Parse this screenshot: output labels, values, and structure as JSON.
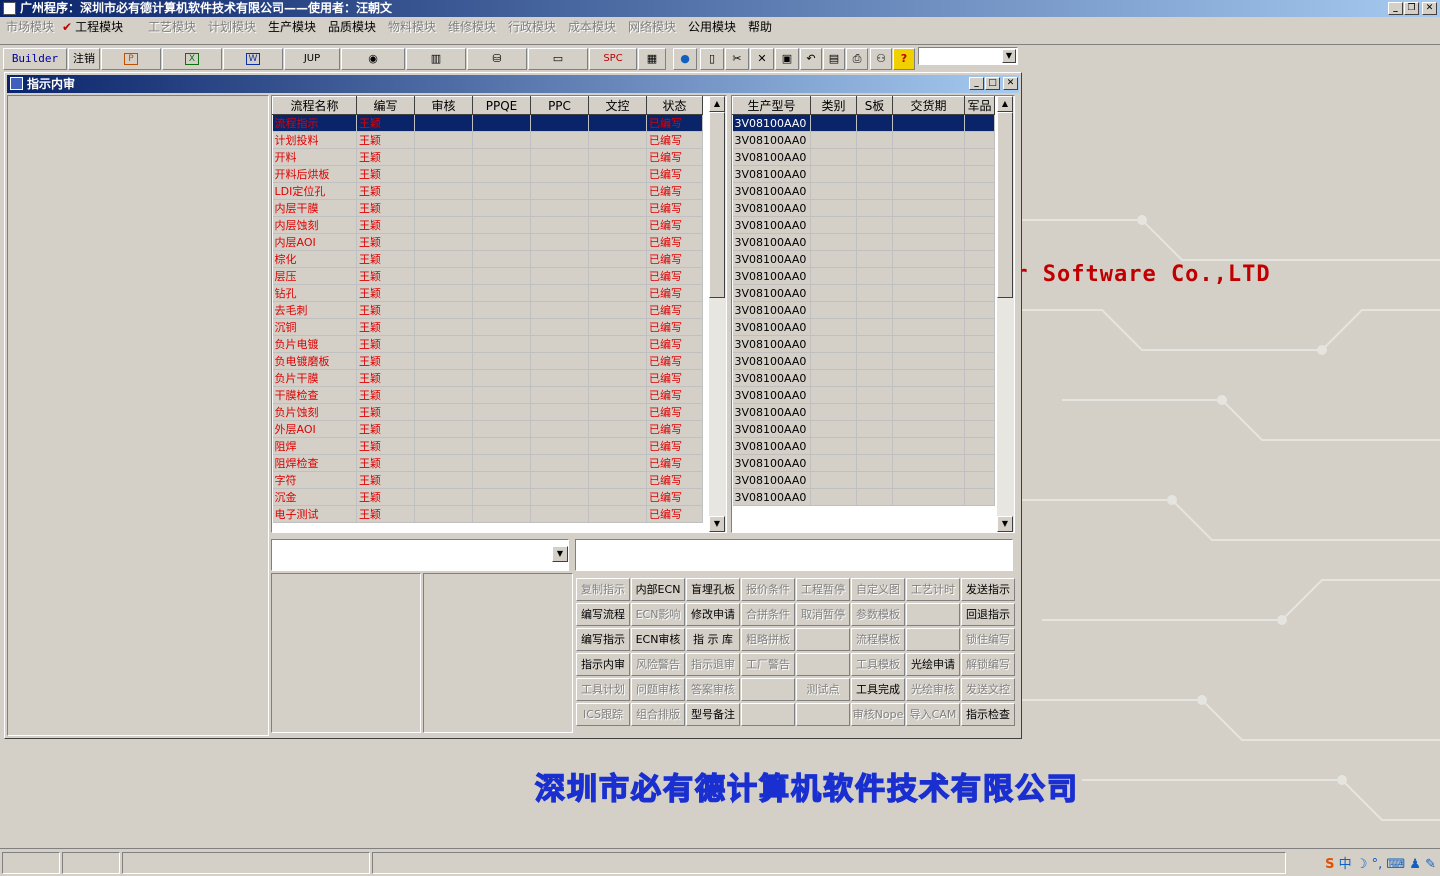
{
  "app": {
    "title": "广州程序：深圳市必有德计算机软件技术有限公司——使用者：汪朝文",
    "min": "_",
    "restore": "❐",
    "close": "✕"
  },
  "menu": [
    {
      "label": "市场模块",
      "enabled": false
    },
    {
      "label": "工程模块",
      "enabled": true,
      "checked": true
    },
    {
      "label": "工艺模块",
      "enabled": false
    },
    {
      "label": "计划模块",
      "enabled": false
    },
    {
      "label": "生产模块",
      "enabled": true
    },
    {
      "label": "品质模块",
      "enabled": true
    },
    {
      "label": "物料模块",
      "enabled": false
    },
    {
      "label": "维修模块",
      "enabled": false
    },
    {
      "label": "行政模块",
      "enabled": false
    },
    {
      "label": "成本模块",
      "enabled": false
    },
    {
      "label": "网络模块",
      "enabled": false
    },
    {
      "label": "公用模块",
      "enabled": true
    },
    {
      "label": "帮助",
      "enabled": true
    }
  ],
  "toolbar": {
    "builder": "Builder",
    "logout": "注销",
    "jup": "JUP",
    "spc": "SPC",
    "combo_value": ""
  },
  "background": {
    "brand_en": "er Software Co.,LTD",
    "brand_cn": "深圳市必有德计算机软件技术有限公司"
  },
  "window": {
    "title": "指示内审"
  },
  "process_grid": {
    "columns": [
      "流程名称",
      "编写",
      "审核",
      "PPQE",
      "PPC",
      "文控",
      "状态"
    ],
    "rows": [
      [
        "流程指示",
        "王颖",
        "",
        "",
        "",
        "",
        "已编写"
      ],
      [
        "计划投料",
        "王颖",
        "",
        "",
        "",
        "",
        "已编写"
      ],
      [
        "开料",
        "王颖",
        "",
        "",
        "",
        "",
        "已编写"
      ],
      [
        "开料后烘板",
        "王颖",
        "",
        "",
        "",
        "",
        "已编写"
      ],
      [
        "LDI定位孔",
        "王颖",
        "",
        "",
        "",
        "",
        "已编写"
      ],
      [
        "内层干膜",
        "王颖",
        "",
        "",
        "",
        "",
        "已编写"
      ],
      [
        "内层蚀刻",
        "王颖",
        "",
        "",
        "",
        "",
        "已编写"
      ],
      [
        "内层AOI",
        "王颖",
        "",
        "",
        "",
        "",
        "已编写"
      ],
      [
        "棕化",
        "王颖",
        "",
        "",
        "",
        "",
        "已编写"
      ],
      [
        "层压",
        "王颖",
        "",
        "",
        "",
        "",
        "已编写"
      ],
      [
        "钻孔",
        "王颖",
        "",
        "",
        "",
        "",
        "已编写"
      ],
      [
        "去毛刺",
        "王颖",
        "",
        "",
        "",
        "",
        "已编写"
      ],
      [
        "沉铜",
        "王颖",
        "",
        "",
        "",
        "",
        "已编写"
      ],
      [
        "负片电镀",
        "王颖",
        "",
        "",
        "",
        "",
        "已编写"
      ],
      [
        "负电镀磨板",
        "王颖",
        "",
        "",
        "",
        "",
        "已编写"
      ],
      [
        "负片干膜",
        "王颖",
        "",
        "",
        "",
        "",
        "已编写"
      ],
      [
        "干膜检查",
        "王颖",
        "",
        "",
        "",
        "",
        "已编写"
      ],
      [
        "负片蚀刻",
        "王颖",
        "",
        "",
        "",
        "",
        "已编写"
      ],
      [
        "外层AOI",
        "王颖",
        "",
        "",
        "",
        "",
        "已编写"
      ],
      [
        "阻焊",
        "王颖",
        "",
        "",
        "",
        "",
        "已编写"
      ],
      [
        "阻焊检查",
        "王颖",
        "",
        "",
        "",
        "",
        "已编写"
      ],
      [
        "字符",
        "王颖",
        "",
        "",
        "",
        "",
        "已编写"
      ],
      [
        "沉金",
        "王颖",
        "",
        "",
        "",
        "",
        "已编写"
      ],
      [
        "电子测试",
        "王颖",
        "",
        "",
        "",
        "",
        "已编写"
      ]
    ]
  },
  "product_grid": {
    "columns": [
      "生产型号",
      "类别",
      "S板",
      "交货期",
      "军品"
    ],
    "rows": [
      "3V08100AA0",
      "3V08100AA0",
      "3V08100AA0",
      "3V08100AA0",
      "3V08100AA0",
      "3V08100AA0",
      "3V08100AA0",
      "3V08100AA0",
      "3V08100AA0",
      "3V08100AA0",
      "3V08100AA0",
      "3V08100AA0",
      "3V08100AA0",
      "3V08100AA0",
      "3V08100AA0",
      "3V08100AA0",
      "3V08100AA0",
      "3V08100AA0",
      "3V08100AA0",
      "3V08100AA0",
      "3V08100AA0",
      "3V08100AA0",
      "3V08100AA0"
    ]
  },
  "inputs": {
    "combo_value": "",
    "text_value": ""
  },
  "action_buttons": [
    [
      {
        "label": "复制指示",
        "enabled": false
      },
      {
        "label": "内部ECN",
        "enabled": true
      },
      {
        "label": "盲埋孔板",
        "enabled": true
      },
      {
        "label": "报价条件",
        "enabled": false
      },
      {
        "label": "工程暂停",
        "enabled": false
      },
      {
        "label": "自定义图",
        "enabled": false
      },
      {
        "label": "工艺计时",
        "enabled": false
      },
      {
        "label": "发送指示",
        "enabled": true
      }
    ],
    [
      {
        "label": "编写流程",
        "enabled": true
      },
      {
        "label": "ECN影响",
        "enabled": false
      },
      {
        "label": "修改申请",
        "enabled": true
      },
      {
        "label": "合拼条件",
        "enabled": false
      },
      {
        "label": "取消暂停",
        "enabled": false
      },
      {
        "label": "参数模板",
        "enabled": false
      },
      {
        "label": "",
        "enabled": false
      },
      {
        "label": "回退指示",
        "enabled": true
      }
    ],
    [
      {
        "label": "编写指示",
        "enabled": true
      },
      {
        "label": "ECN审核",
        "enabled": true
      },
      {
        "label": "指 示 库",
        "enabled": true
      },
      {
        "label": "粗略拼板",
        "enabled": false
      },
      {
        "label": "",
        "enabled": false
      },
      {
        "label": "流程模板",
        "enabled": false
      },
      {
        "label": "",
        "enabled": false
      },
      {
        "label": "锁住编写",
        "enabled": false
      }
    ],
    [
      {
        "label": "指示内审",
        "enabled": true
      },
      {
        "label": "风险警告",
        "enabled": false
      },
      {
        "label": "指示退审",
        "enabled": false
      },
      {
        "label": "工厂警告",
        "enabled": false
      },
      {
        "label": "",
        "enabled": false
      },
      {
        "label": "工具模板",
        "enabled": false
      },
      {
        "label": "光绘申请",
        "enabled": true
      },
      {
        "label": "解锁编写",
        "enabled": false
      }
    ],
    [
      {
        "label": "工具计划",
        "enabled": false
      },
      {
        "label": "问题审核",
        "enabled": false
      },
      {
        "label": "答案审核",
        "enabled": false
      },
      {
        "label": "",
        "enabled": false
      },
      {
        "label": "测试点",
        "enabled": false
      },
      {
        "label": "工具完成",
        "enabled": true
      },
      {
        "label": "光绘审核",
        "enabled": false
      },
      {
        "label": "发送文控",
        "enabled": false
      }
    ],
    [
      {
        "label": "ICS跟踪",
        "enabled": false
      },
      {
        "label": "组合排版",
        "enabled": false
      },
      {
        "label": "型号备注",
        "enabled": true
      },
      {
        "label": "",
        "enabled": false
      },
      {
        "label": "",
        "enabled": false
      },
      {
        "label": "审核Nope",
        "enabled": false
      },
      {
        "label": "导入CAM",
        "enabled": false
      },
      {
        "label": "指示检查",
        "enabled": true
      }
    ]
  ],
  "tray": {
    "ime": "中"
  }
}
